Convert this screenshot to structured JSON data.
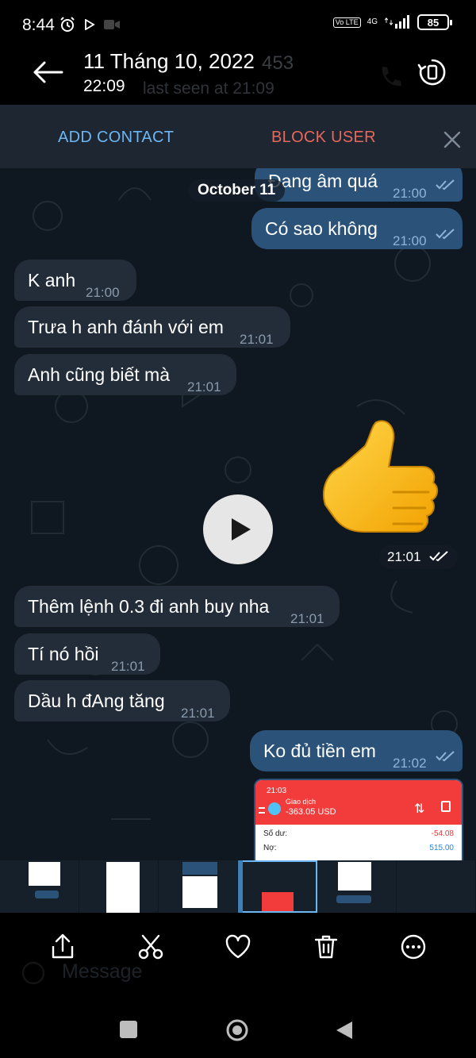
{
  "status_bar": {
    "time": "8:44",
    "network": "4G",
    "volte": "Vo LTE",
    "battery": "85"
  },
  "header": {
    "date": "11 Tháng 10, 2022",
    "time": "22:09",
    "ghost_name": "453",
    "ghost_last_seen": "last seen at 21:09"
  },
  "action_bar": {
    "add_contact": "ADD CONTACT",
    "block_user": "BLOCK USER"
  },
  "chat": {
    "date_divider": "October 11",
    "messages": [
      {
        "dir": "out",
        "text": "Đang âm quá",
        "time": "21:00"
      },
      {
        "dir": "out",
        "text": "Có sao không",
        "time": "21:00"
      },
      {
        "dir": "in",
        "text": "K anh",
        "time": "21:00"
      },
      {
        "dir": "in",
        "text": "Trưa h anh đánh với em",
        "time": "21:01"
      },
      {
        "dir": "in",
        "text": "Anh cũng biết mà",
        "time": "21:01"
      },
      {
        "dir": "in",
        "text": "Thêm lệnh 0.3 đi anh buy nha",
        "time": "21:01"
      },
      {
        "dir": "in",
        "text": "Tí nó hồi",
        "time": "21:01"
      },
      {
        "dir": "in",
        "text": "Dầu h đAng tăng",
        "time": "21:01"
      },
      {
        "dir": "out",
        "text": "Ko đủ tiền em",
        "time": "21:02"
      }
    ],
    "sticker_time": "21:01",
    "photo": {
      "time": "21:03",
      "title": "Giao dịch",
      "amount": "-363.05 USD",
      "rows": [
        {
          "label": "Số dư:",
          "value": "-54.08"
        },
        {
          "label": "Nợ:",
          "value": "515.00"
        }
      ]
    }
  },
  "input": {
    "placeholder": "Message"
  },
  "colors": {
    "accent": "#6cb6f3",
    "danger": "#e6685c",
    "bubble_out": "#2b5279",
    "bubble_in": "#222d39",
    "chat_bg": "#0f1720"
  }
}
